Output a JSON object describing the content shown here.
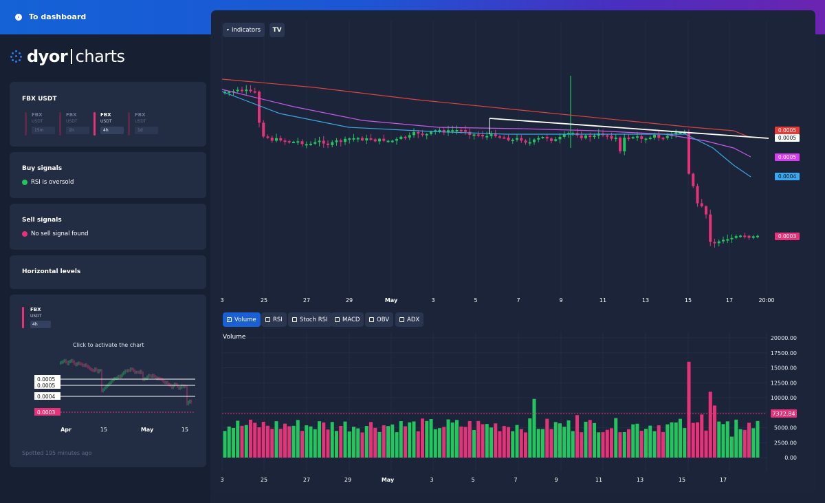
{
  "topbar": {
    "back_label": "To dashboard"
  },
  "logo": {
    "bold": "dyor",
    "light": "charts"
  },
  "pairs_card": {
    "title": "FBX USDT",
    "pairs": [
      {
        "symbol": "FBX",
        "quote": "USDT",
        "tf": "15m",
        "active": false
      },
      {
        "symbol": "FBX",
        "quote": "USDT",
        "tf": "1h",
        "active": false
      },
      {
        "symbol": "FBX",
        "quote": "USDT",
        "tf": "4h",
        "active": true
      },
      {
        "symbol": "FBX",
        "quote": "USDT",
        "tf": "1d",
        "active": false
      }
    ]
  },
  "buy_card": {
    "title": "Buy signals",
    "text": "RSI is oversold",
    "color": "#22c55e"
  },
  "sell_card": {
    "title": "Sell signals",
    "text": "No sell signal found",
    "color": "#e5337a"
  },
  "levels_card": {
    "title": "Horizontal levels"
  },
  "mini_chart": {
    "symbol": "FBX",
    "quote": "USDT",
    "tf": "4h",
    "hint": "Click to activate the chart",
    "levels": [
      "0.0005",
      "0.0005",
      "0.0004"
    ],
    "current": "0.0003",
    "x_labels": [
      "Apr",
      "15",
      "May",
      "15"
    ],
    "footer": "Spotted 195 minutes ago"
  },
  "toolbar": {
    "indicators_label": "Indicators",
    "tv_icon": "tradingview-logo-icon"
  },
  "indicator_toggles": [
    {
      "label": "Volume",
      "on": true
    },
    {
      "label": "RSI",
      "on": false
    },
    {
      "label": "Stoch RSI",
      "on": false
    },
    {
      "label": "MACD",
      "on": false
    },
    {
      "label": "OBV",
      "on": false
    },
    {
      "label": "ADX",
      "on": false
    }
  ],
  "price_chart": {
    "x_labels": [
      "3",
      "25",
      "27",
      "29",
      "May",
      "3",
      "5",
      "7",
      "9",
      "11",
      "13",
      "15",
      "17",
      "20:00"
    ],
    "price_tags": [
      {
        "value": "0.0005",
        "color": "#e53935",
        "text_color": "#ffffff"
      },
      {
        "value": "0.0005",
        "color": "#ffffff",
        "text_color": "#111111"
      },
      {
        "value": "0.0005",
        "color": "#d63cf0",
        "text_color": "#ffffff"
      },
      {
        "value": "0.0004",
        "color": "#38a8f0",
        "text_color": "#111111"
      },
      {
        "value": "0.0003",
        "color": "#e5337a",
        "text_color": "#ffffff"
      }
    ]
  },
  "volume_chart": {
    "title": "Volume",
    "y_labels": [
      "20000.00",
      "17500.00",
      "15000.00",
      "12500.00",
      "10000.00",
      "7500.00",
      "5000.00",
      "2500.00",
      "0.00"
    ],
    "current_tag": "7372.84",
    "x_labels": [
      "3",
      "25",
      "27",
      "29",
      "May",
      "3",
      "5",
      "7",
      "9",
      "11",
      "13",
      "15",
      "17"
    ],
    "up_color": "#22c55e",
    "down_color": "#e5337a"
  }
}
